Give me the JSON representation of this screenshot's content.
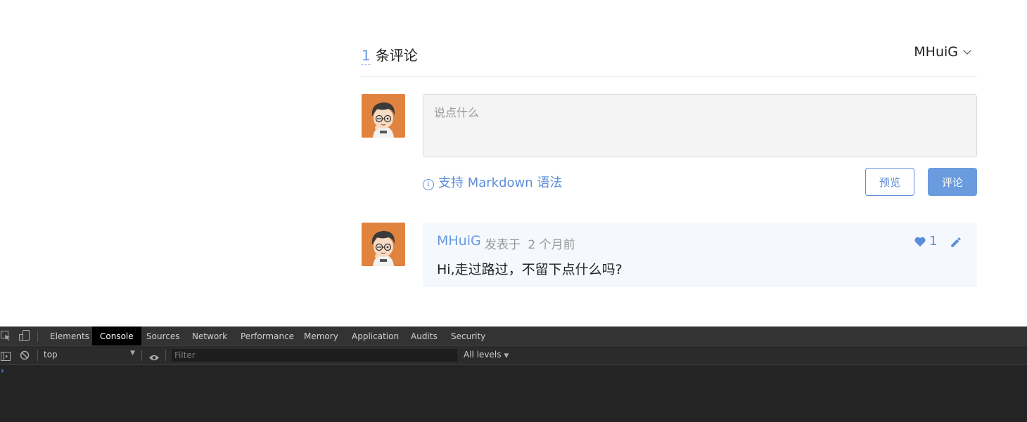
{
  "comments": {
    "count": "1",
    "count_label": "条评论",
    "current_user": "MHuiG",
    "editor_placeholder": "说点什么",
    "markdown_hint": "支持 Markdown 语法",
    "preview_label": "预览",
    "submit_label": "评论",
    "list": [
      {
        "author": "MHuiG",
        "posted_prefix": "发表于",
        "time": "2 个月前",
        "text": "Hi,走过路过，不留下点什么吗?",
        "likes": "1"
      }
    ]
  },
  "colors": {
    "accent": "#6a9bde",
    "avatar_bg": "#e0833f"
  },
  "devtools": {
    "tabs": [
      "Elements",
      "Console",
      "Sources",
      "Network",
      "Performance",
      "Memory",
      "Application",
      "Audits",
      "Security"
    ],
    "active_tab": "Console",
    "context": "top",
    "filter_placeholder": "Filter",
    "levels": "All levels",
    "icons": [
      "inspect-element-icon",
      "device-toolbar-icon",
      "sidebar-toggle-icon",
      "clear-console-icon",
      "eye-icon"
    ]
  }
}
